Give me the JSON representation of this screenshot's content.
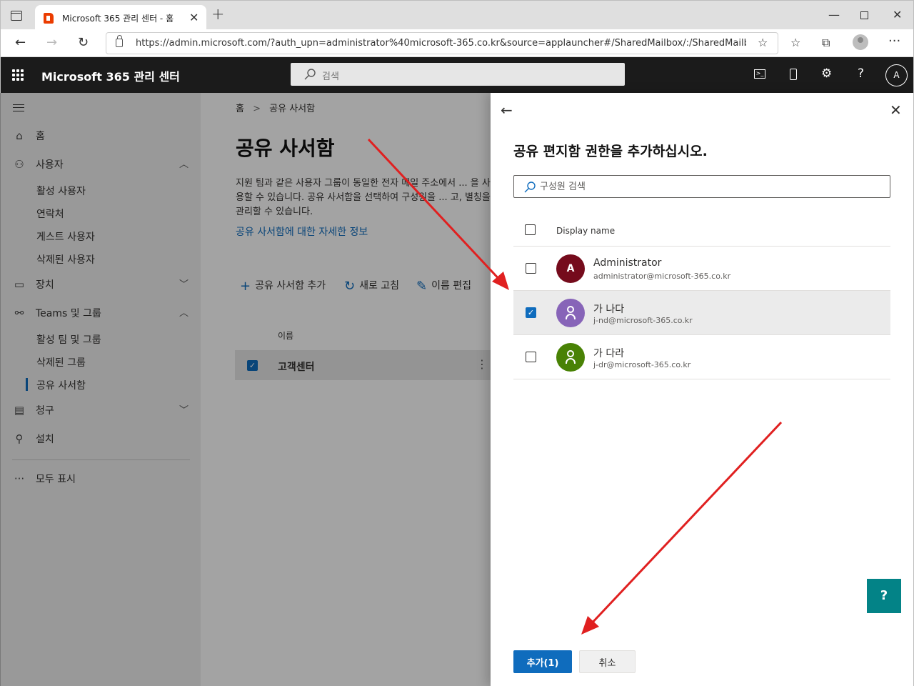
{
  "browser": {
    "tab_title": "Microsoft 365 관리 센터 - 홈",
    "url": "https://admin.microsoft.com/?auth_upn=administrator%40microsoft-365.co.kr&source=applauncher#/SharedMailbox/:/SharedMailboxD..."
  },
  "header": {
    "app_title": "Microsoft 365 관리 센터",
    "search_placeholder": "검색",
    "avatar_initial": "A"
  },
  "sidebar": {
    "items": [
      {
        "label": "홈"
      },
      {
        "label": "사용자"
      },
      {
        "label": "장치"
      },
      {
        "label": "Teams 및 그룹"
      },
      {
        "label": "청구"
      },
      {
        "label": "설치"
      },
      {
        "label": "모두 표시"
      }
    ],
    "users_sub": [
      "활성 사용자",
      "연락처",
      "게스트 사용자",
      "삭제된 사용자"
    ],
    "teams_sub": [
      "활성 팀 및 그룹",
      "삭제된 그룹",
      "공유 사서함"
    ]
  },
  "main": {
    "breadcrumb_home": "홈",
    "breadcrumb_current": "공유 사서함",
    "title": "공유 사서함",
    "description": "지원 팀과 같은 사용자 그룹이 동일한 전자 메일 주소에서 ... 을 사용할 수 있습니다. 공유 사서함을 선택하여 구성원을 ... 고, 별칭을 관리할 수 있습니다.",
    "learn_more_link": "공유 사서함에 대한 자세한 정보",
    "commands": {
      "add": "공유 사서함 추가",
      "refresh": "새로 고침",
      "edit_name": "이름 편집"
    },
    "column_name": "이름",
    "rows": [
      {
        "name": "고객센터"
      }
    ]
  },
  "panel": {
    "title": "공유 편지함 권한을 추가하십시오.",
    "search_placeholder": "구성원 검색",
    "column_display_name": "Display name",
    "members": [
      {
        "name": "Administrator",
        "email": "administrator@microsoft-365.co.kr",
        "initial": "A",
        "checked": false,
        "color": "#750b1c"
      },
      {
        "name": "가 나다",
        "email": "j-nd@microsoft-365.co.kr",
        "initial": "",
        "checked": true,
        "color": "#8764b8"
      },
      {
        "name": "가 다라",
        "email": "j-dr@microsoft-365.co.kr",
        "initial": "",
        "checked": false,
        "color": "#498205"
      }
    ],
    "add_button": "추가(1)",
    "cancel_button": "취소"
  },
  "colors": {
    "accent": "#0f6cbd",
    "annotation_arrow": "#e02020",
    "help_fab": "#038387"
  }
}
